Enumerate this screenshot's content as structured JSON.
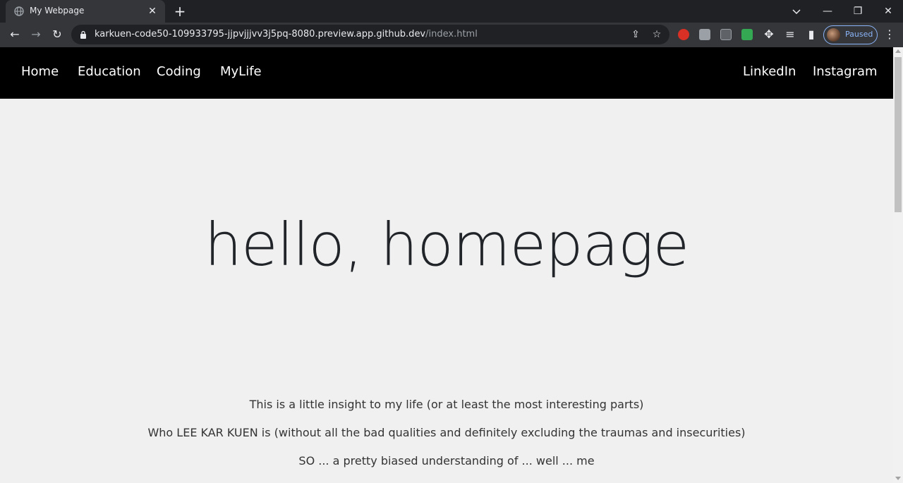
{
  "browser": {
    "tab": {
      "title": "My Webpage",
      "close_glyph": "✕"
    },
    "new_tab_glyph": "+",
    "window": {
      "minimize": "—",
      "restore": "❐",
      "close": "✕"
    },
    "address": {
      "url_host": "karkuen-code50-109933795-jjpvjjjvv3j5pq-8080.preview.app.github.dev",
      "url_path": "/index.html"
    },
    "profile": {
      "label": "Paused"
    },
    "icons": {
      "back": "←",
      "forward": "→",
      "reload": "↻",
      "share": "⇪",
      "bookmark": "☆",
      "extensions": "✥",
      "media": "≡",
      "sidepanel": "▮",
      "menu": "⋮"
    }
  },
  "nav": {
    "left": [
      "Home",
      "Education",
      "Coding",
      "MyLife"
    ],
    "right": [
      "LinkedIn",
      "Instagram"
    ]
  },
  "hero": {
    "title": "hello, homepage"
  },
  "intro": [
    "This is a little insight to my life (or at least the most interesting parts)",
    "Who LEE KAR KUEN is (without all the bad qualities and definitely excluding the traumas and insecurities)",
    "SO ... a pretty biased understanding of ... well ... me"
  ],
  "colors": {
    "navbar_bg": "#000000",
    "page_bg": "#f0f0f0",
    "hero_text": "#212529",
    "chrome_dark": "#202124",
    "chrome_mid": "#35363a",
    "profile_accent": "#8ab4f8"
  }
}
